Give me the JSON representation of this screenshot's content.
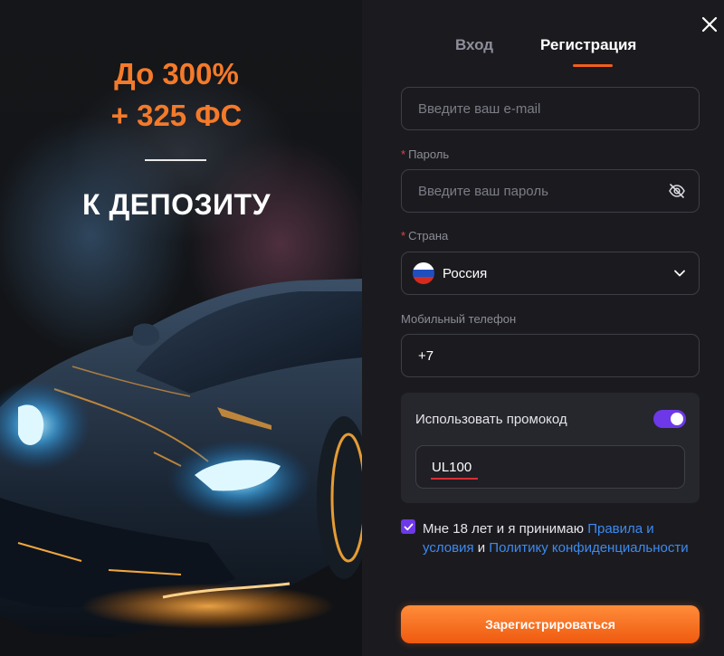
{
  "promo": {
    "headline_line1": "До 300%",
    "headline_line2": "+ 325 ФС",
    "subheadline": "К ДЕПОЗИТУ"
  },
  "tabs": {
    "login": "Вход",
    "register": "Регистрация",
    "active": "register"
  },
  "form": {
    "email": {
      "placeholder": "Введите ваш e-mail",
      "value": ""
    },
    "password": {
      "label": "Пароль",
      "required_mark": "*",
      "placeholder": "Введите ваш пароль",
      "value": ""
    },
    "country": {
      "label": "Страна",
      "required_mark": "*",
      "value": "Россия",
      "flag": "russia-flag"
    },
    "phone": {
      "label": "Мобильный телефон",
      "value": "+7"
    },
    "promo_code": {
      "toggle_label": "Использовать промокод",
      "enabled": true,
      "value": "UL100"
    },
    "consent": {
      "text_before": "Мне 18 лет и я принимаю ",
      "terms_link": "Правила и условия",
      "and": " и ",
      "privacy_link": "Политику конфиденциальности",
      "checked": true
    },
    "submit_label": "Зарегистрироваться"
  },
  "colors": {
    "accent_orange": "#f47a2a",
    "toggle_purple": "#6d38e8",
    "link_blue": "#3d8af0",
    "required_red": "#e0434b",
    "panel_bg": "#1b1b1f"
  },
  "icons": [
    "close-icon",
    "eye-off-icon",
    "chevron-down-icon",
    "checkmark-icon",
    "russia-flag-icon"
  ]
}
